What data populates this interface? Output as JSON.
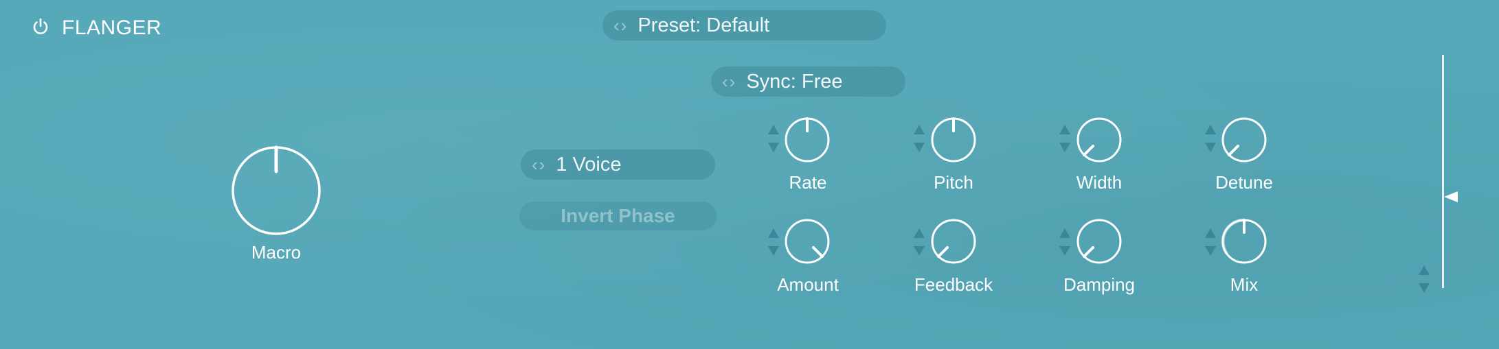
{
  "plugin": {
    "name": "FLANGER",
    "power_icon": "power-icon"
  },
  "preset": {
    "label": "Preset: Default"
  },
  "sync": {
    "label": "Sync: Free"
  },
  "voices": {
    "label": "1 Voice"
  },
  "invert_phase": {
    "label": "Invert Phase"
  },
  "macro": {
    "label": "Macro",
    "value": 0.5
  },
  "knobs": [
    {
      "label": "Rate",
      "value": 0.5
    },
    {
      "label": "Pitch",
      "value": 0.5
    },
    {
      "label": "Width",
      "value": 0.2
    },
    {
      "label": "Detune",
      "value": 0.2
    },
    {
      "label": "Amount",
      "value": 0.8
    },
    {
      "label": "Feedback",
      "value": 0.2
    },
    {
      "label": "Damping",
      "value": 0.2
    },
    {
      "label": "Mix",
      "value": 0.5
    }
  ],
  "colors": {
    "background": "#55a8b8",
    "foreground": "#ffffff",
    "pill": "#3a8fa2"
  }
}
